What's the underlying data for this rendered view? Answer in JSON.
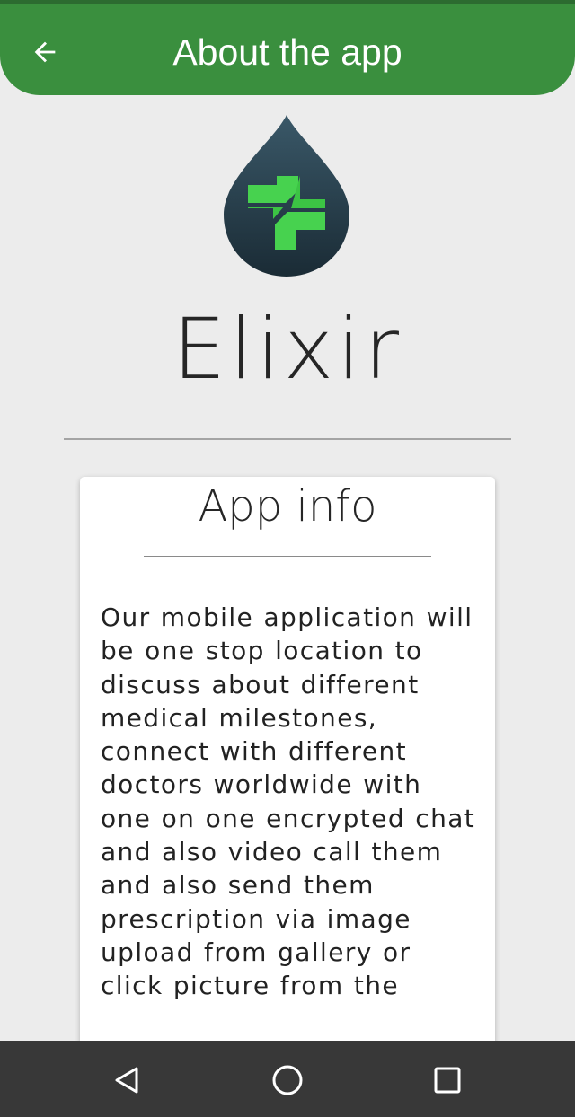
{
  "app_bar": {
    "title": "About the app",
    "back_icon": "arrow-back-icon",
    "background": "#3a8f3e",
    "status_strip": "#2c6b30"
  },
  "brand": {
    "logo_icon": "elixir-drop-cross-logo",
    "name": "Elixir",
    "logo_colors": {
      "drop_top": "#3a5868",
      "drop_bottom": "#1a2b35",
      "cross": "#47d24f"
    }
  },
  "info_card": {
    "title": "App info",
    "body": "Our mobile application will be one stop location to discuss about different medical milestones, connect with different doctors worldwide with one on one encrypted chat and also video call them and also send them prescription via image upload from gallery or click picture from the"
  },
  "nav_bar": {
    "background": "#383838",
    "back_icon": "nav-back-icon",
    "home_icon": "nav-home-icon",
    "recents_icon": "nav-recents-icon"
  }
}
